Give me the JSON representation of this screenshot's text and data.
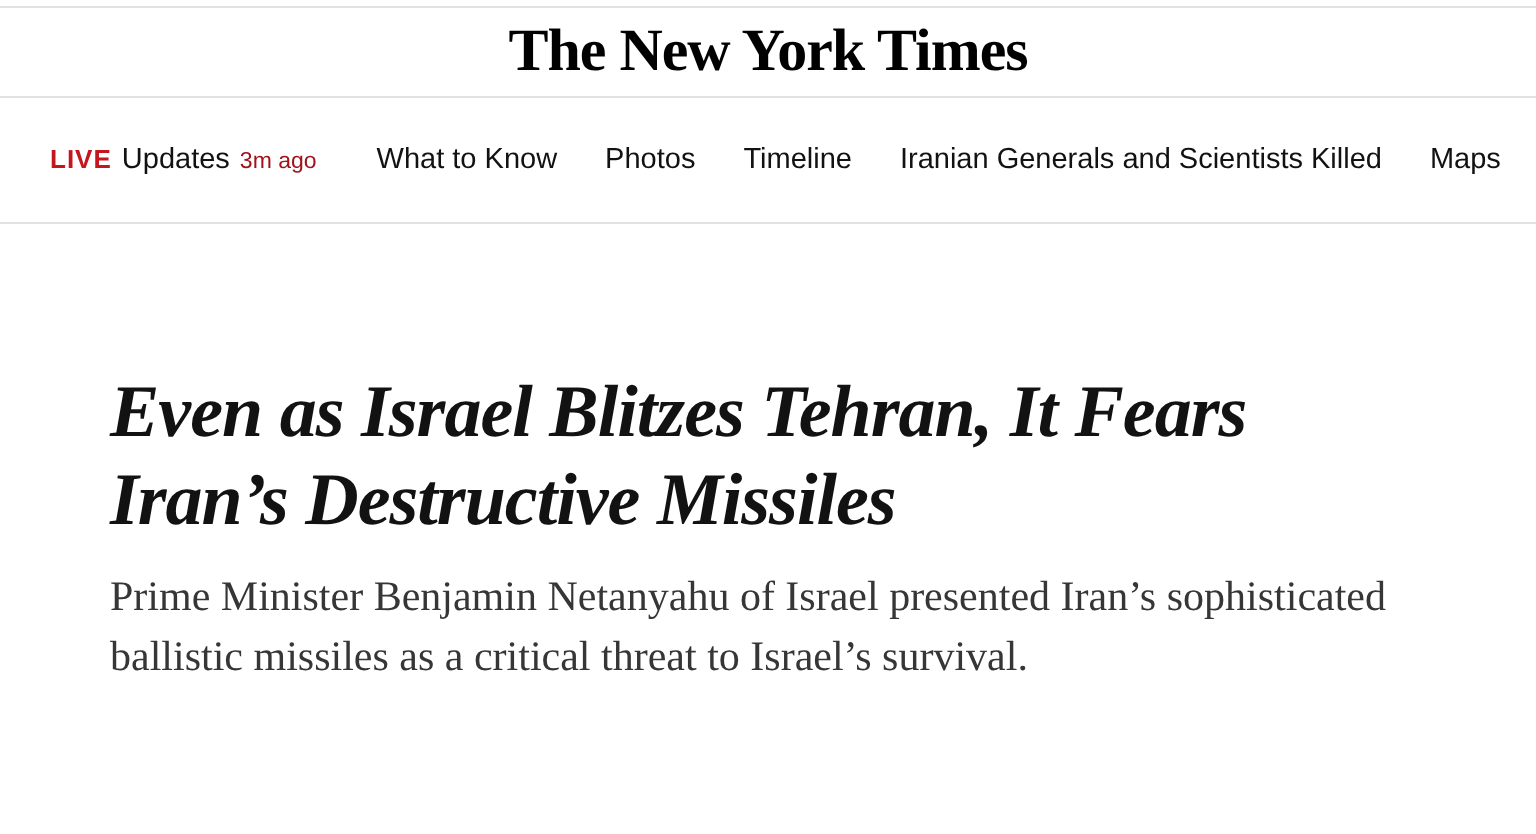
{
  "masthead": {
    "logo": "The New York Times"
  },
  "nav": {
    "live_label": "LIVE",
    "live_title": "Updates",
    "live_time": "3m ago",
    "items": [
      "What to Know",
      "Photos",
      "Timeline",
      "Iranian Generals and Scientists Killed",
      "Maps"
    ]
  },
  "article": {
    "headline": "Even as Israel Blitzes Tehran, It Fears Iran’s Destructive Missiles",
    "summary": "Prime Minister Benjamin Netanyahu of Israel presented Iran’s sophisticated ballistic missiles as a critical threat to Israel’s survival."
  }
}
